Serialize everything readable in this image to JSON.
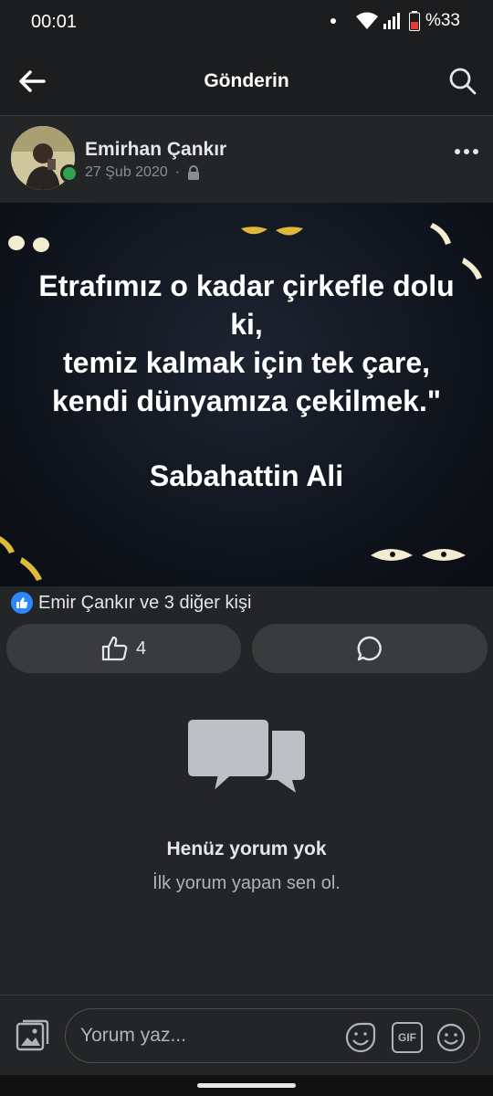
{
  "status": {
    "time": "00:01",
    "battery": "%33"
  },
  "header": {
    "title": "Gönderin"
  },
  "post": {
    "author": "Emirhan Çankır",
    "date": "27 Şub 2020",
    "quote_lines": [
      "Etrafımız o kadar çirkefle dolu",
      "ki,",
      "temiz kalmak için tek çare,",
      "kendi dünyamıza çekilmek.\""
    ],
    "quote_author": "Sabahattin Ali",
    "reactions_text": "Emir Çankır ve 3 diğer kişi",
    "like_count": "4"
  },
  "comments": {
    "empty_title": "Henüz yorum yok",
    "empty_subtitle": "İlk yorum yapan sen ol."
  },
  "composer": {
    "placeholder": "Yorum yaz...",
    "gif_label": "GIF"
  },
  "colors": {
    "accent": "#2d88ff",
    "online": "#31a24c",
    "background": "#242526"
  }
}
